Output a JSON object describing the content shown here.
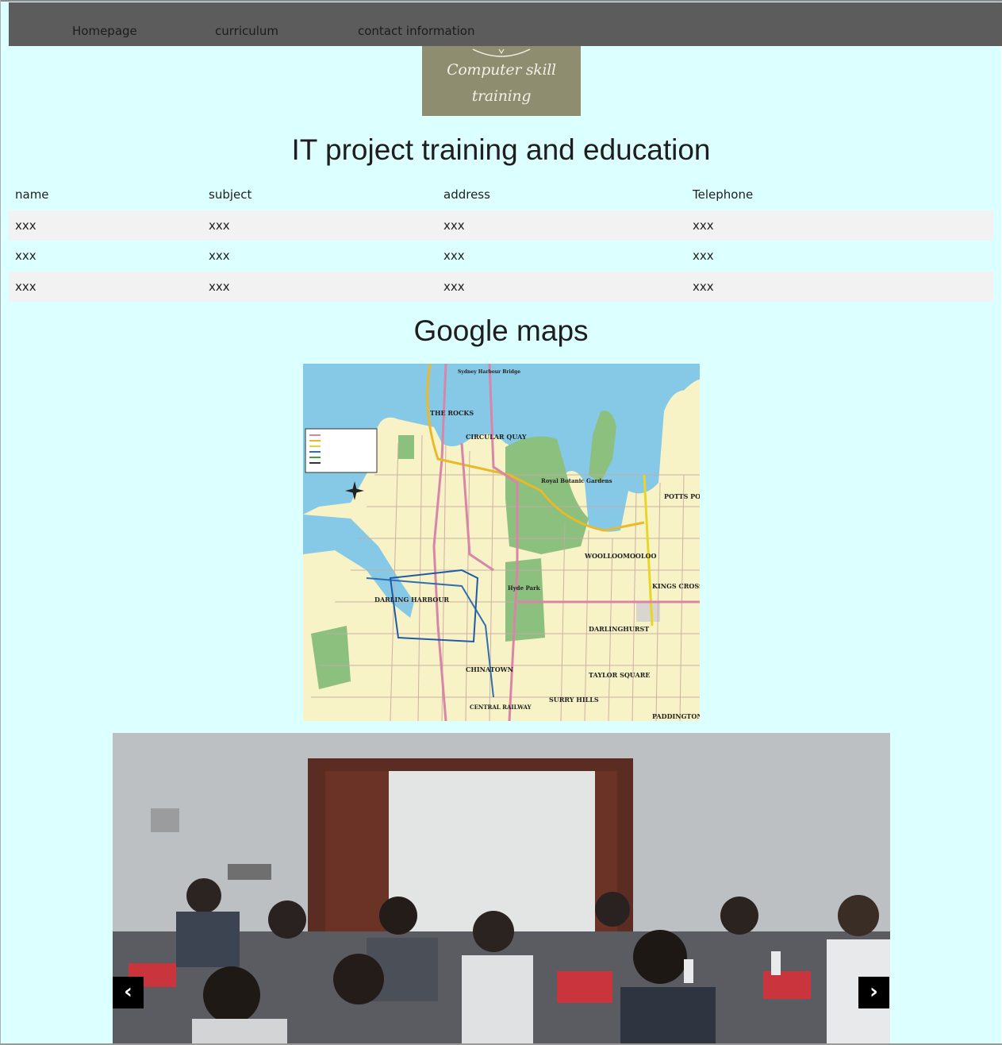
{
  "nav": {
    "items": [
      {
        "label": "Homepage"
      },
      {
        "label": "curriculum"
      },
      {
        "label": "contact information"
      }
    ]
  },
  "logo": {
    "line1": "Computer skill",
    "line2": "training"
  },
  "main": {
    "title": "IT project training and education"
  },
  "table": {
    "headers": [
      "name",
      "subject",
      "address",
      "Telephone"
    ],
    "rows": [
      [
        "xxx",
        "xxx",
        "xxx",
        "xxx"
      ],
      [
        "xxx",
        "xxx",
        "xxx",
        "xxx"
      ],
      [
        "xxx",
        "xxx",
        "xxx",
        "xxx"
      ]
    ]
  },
  "map_section": {
    "title": "Google maps",
    "labels": {
      "rocks": "THE ROCKS",
      "quay": "CIRCULAR QUAY",
      "botanic": "Royal Botanic Gardens",
      "potts": "POTTS POINT",
      "woolloomooloo": "WOOLLOOMOOLOO",
      "kings": "KINGS CROSS",
      "darling": "DARLING HARBOUR",
      "hyde": "Hyde Park",
      "darlinghurst": "DARLINGHURST",
      "chinatown": "CHINATOWN",
      "taylor": "TAYLOR SQUARE",
      "surry": "SURRY HILLS",
      "central": "CENTRAL RAILWAY",
      "paddington": "PADDINGTON",
      "bridge": "Sydney Harbour Bridge"
    }
  },
  "slider": {
    "prev_label": "‹",
    "next_label": "›"
  }
}
